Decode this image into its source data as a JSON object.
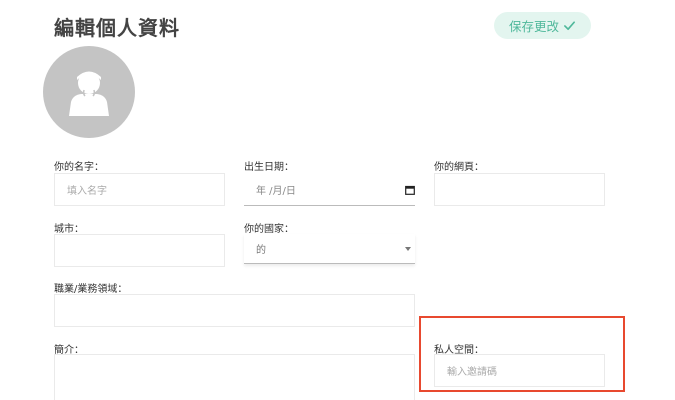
{
  "header": {
    "title": "編輯個人資料",
    "save_label": "保存更改",
    "save_icon": "check-icon",
    "save_color": "#4fb89b"
  },
  "avatar": {
    "icon": "user-avatar-placeholder"
  },
  "form": {
    "name": {
      "label": "你的名字：",
      "placeholder": "填入名字",
      "value": ""
    },
    "birthday": {
      "label": "出生日期：",
      "value": "年 /月/日"
    },
    "website": {
      "label": "你的網頁：",
      "value": ""
    },
    "city": {
      "label": "城市：",
      "value": ""
    },
    "country": {
      "label": "你的國家：",
      "selected": "的"
    },
    "occupation": {
      "label": "職業/業務領域：",
      "value": ""
    },
    "bio": {
      "label": "簡介：",
      "value": ""
    },
    "private_space": {
      "label": "私人空間：",
      "placeholder": "輸入邀請碼",
      "value": ""
    }
  },
  "highlight_color": "#e8492f"
}
